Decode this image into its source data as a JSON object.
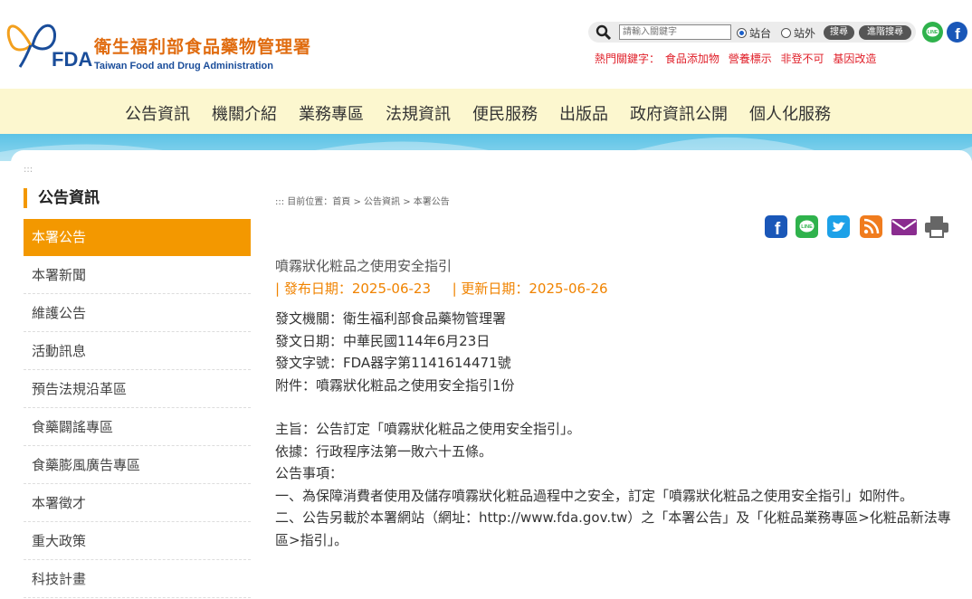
{
  "header": {
    "logo_zh": "衛生福利部食品藥物管理署",
    "logo_en": "Taiwan Food and Drug Administration",
    "fda_mark": "FDA",
    "search": {
      "placeholder": "請輸入關鍵字",
      "radio_site": "站台",
      "radio_external": "站外",
      "search_btn": "搜尋",
      "advanced_btn": "進階搜尋"
    },
    "hot_label": "熱門關鍵字：",
    "hot_keywords": [
      "食品添加物",
      "營養標示",
      "非登不可",
      "基因改造"
    ]
  },
  "nav": {
    "items": [
      "公告資訊",
      "機關介紹",
      "業務專區",
      "法規資訊",
      "便民服務",
      "出版品",
      "政府資訊公開",
      "個人化服務"
    ]
  },
  "anchor": ":::",
  "sidebar": {
    "title": "公告資訊",
    "items": [
      "本署公告",
      "本署新聞",
      "維護公告",
      "活動訊息",
      "預告法規沿革區",
      "食藥闢謠專區",
      "食藥膨風廣告專區",
      "本署徵才",
      "重大政策",
      "科技計畫"
    ]
  },
  "breadcrumb": "::: 目前位置：首頁 > 公告資訊 > 本署公告",
  "article": {
    "title": "噴霧狀化粧品之使用安全指引",
    "published": "| 發布日期：2025-06-23",
    "updated": "| 更新日期：2025-06-26",
    "lines": [
      "發文機關：衛生福利部食品藥物管理署",
      "發文日期：中華民國114年6月23日",
      "發文字號：FDA器字第1141614471號",
      "附件：噴霧狀化粧品之使用安全指引1份"
    ],
    "lines2": [
      "主旨：公告訂定「噴霧狀化粧品之使用安全指引」。",
      "依據：行政程序法第一敗六十五條。",
      "公告事項：",
      "一、為保障消費者使用及儲存噴霧狀化粧品過程中之安全，訂定「噴霧狀化粧品之使用安全指引」如附件。",
      "二、公告另載於本署網站（網址：http://www.fda.gov.tw）之「本署公告」及「化粧品業務專區>化粧品新法專區>指引」。"
    ]
  },
  "colors": {
    "accent": "#f39800",
    "nav_bg": "#fcf7cf",
    "band": "#5cc3e6",
    "facebook": "#1a57b8",
    "line": "#2fb24c",
    "twitter": "#1da1e8",
    "rss": "#f07c1e",
    "mail": "#8a2c8f",
    "print": "#666666"
  }
}
